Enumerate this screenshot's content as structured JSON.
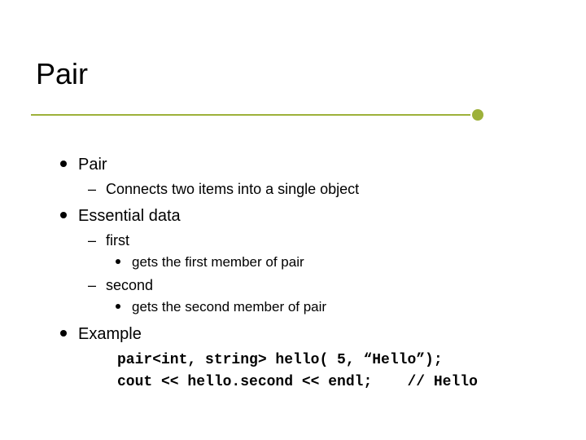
{
  "title": "Pair",
  "bullets": {
    "pair": {
      "label": "Pair",
      "sub": "Connects two items into a single object"
    },
    "essential": {
      "label": "Essential data",
      "first": {
        "label": "first",
        "desc": "gets the first member of pair"
      },
      "second": {
        "label": "second",
        "desc": "gets the second member of pair"
      }
    },
    "example": {
      "label": "Example",
      "code_line1": "pair<int, string> hello( 5, “Hello”);",
      "code_line2": "cout << hello.second << endl;    // Hello"
    }
  }
}
